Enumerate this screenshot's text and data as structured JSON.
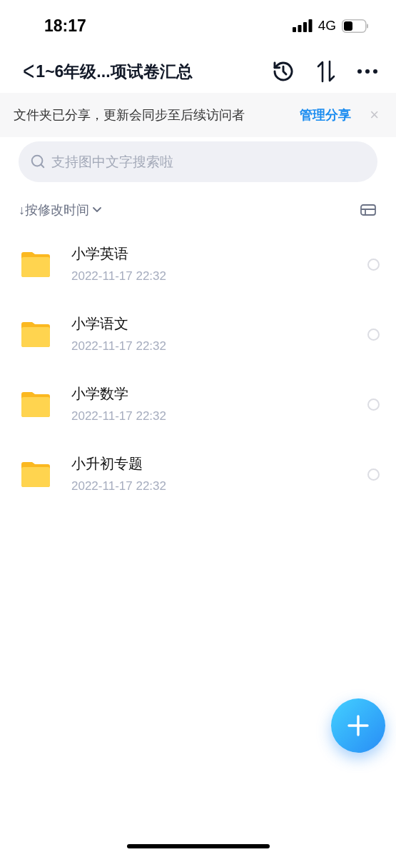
{
  "status_bar": {
    "time": "18:17",
    "network": "4G"
  },
  "header": {
    "back": "<",
    "title": "1~6年级...项试卷汇总"
  },
  "share_banner": {
    "message": "文件夹已分享，更新会同步至后续访问者",
    "action": "管理分享",
    "close": "×"
  },
  "search": {
    "placeholder": "支持图中文字搜索啦"
  },
  "sort": {
    "arrow": "↓",
    "label": "按修改时间"
  },
  "folders": [
    {
      "name": "小学英语",
      "date": "2022-11-17 22:32",
      "selected": false
    },
    {
      "name": "小学语文",
      "date": "2022-11-17 22:32",
      "selected": false
    },
    {
      "name": "小学数学",
      "date": "2022-11-17 22:32",
      "selected": false
    },
    {
      "name": "小升初专题",
      "date": "2022-11-17 22:32",
      "selected": false
    }
  ]
}
